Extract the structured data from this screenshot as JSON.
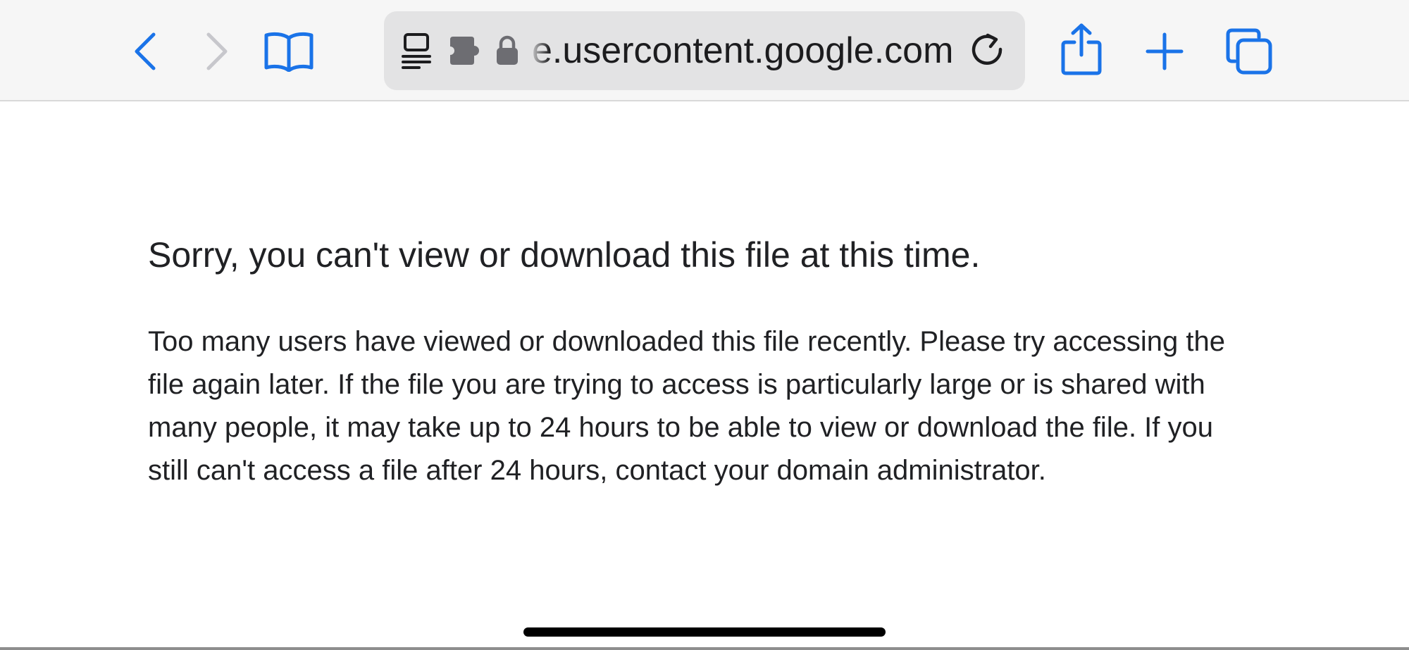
{
  "toolbar": {
    "accent_color": "#1a73e8",
    "disabled_color": "#c7c7cc",
    "back_icon": "chevron-left-icon",
    "forward_icon": "chevron-right-icon",
    "bookmarks_icon": "open-book-icon",
    "share_icon": "share-icon",
    "new_tab_icon": "plus-icon",
    "tabs_icon": "tabs-overview-icon"
  },
  "address_bar": {
    "url": "e.usercontent.google.com",
    "reader_icon": "reader-mode-icon",
    "extension_icon": "puzzle-extension-icon",
    "lock_icon": "lock-icon",
    "reload_icon": "reload-icon"
  },
  "page": {
    "title": "Sorry, you can't view or download this file at this time.",
    "message": "Too many users have viewed or downloaded this file recently. Please try accessing the file again later. If the file you are trying to access is particularly large or is shared with many people, it may take up to 24 hours to be able to view or download the file. If you still can't access a file after 24 hours, contact your domain administrator."
  }
}
